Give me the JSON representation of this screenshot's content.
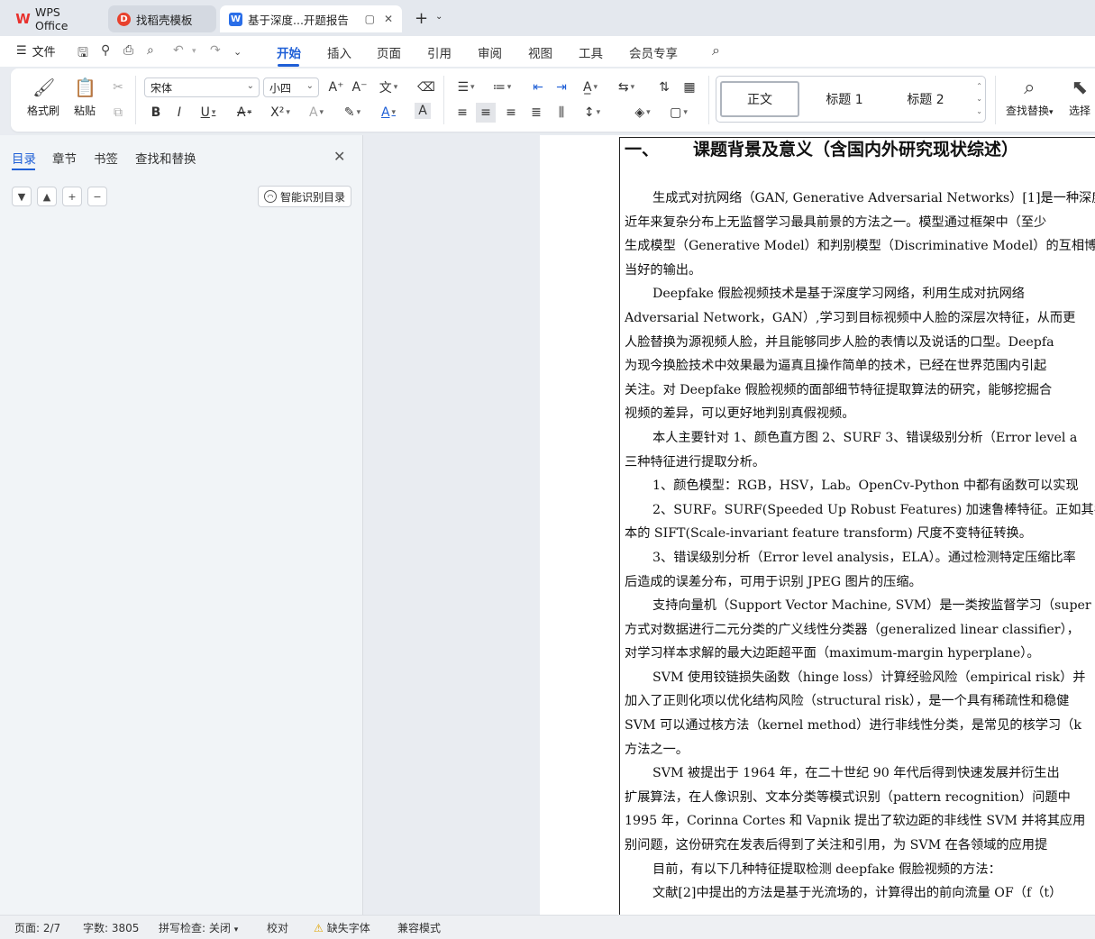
{
  "tabs": {
    "wps": "WPS Office",
    "templates": "找稻壳模板",
    "document": "基于深度...开题报告"
  },
  "menu": {
    "file": "文件",
    "items": [
      "开始",
      "插入",
      "页面",
      "引用",
      "审阅",
      "视图",
      "工具",
      "会员专享"
    ],
    "active": "开始"
  },
  "ribbon": {
    "format_painter": "格式刷",
    "paste": "粘贴",
    "font_name": "宋体",
    "font_size": "小四",
    "styles": [
      "正文",
      "标题 1",
      "标题 2"
    ],
    "find_replace": "查找替换",
    "select": "选择"
  },
  "nav": {
    "tabs": [
      "目录",
      "章节",
      "书签",
      "查找和替换"
    ],
    "active_tab": "目录",
    "smart_toc": "智能识别目录"
  },
  "document": {
    "heading": {
      "number": "一、",
      "text": "课题背景及意义（含国内外研究现状综述）"
    },
    "lines": [
      {
        "text": "生成式对抗网络（GAN, Generative Adversarial Networks）[1]是一种深度",
        "indent": true
      },
      {
        "text": "近年来复杂分布上无监督学习最具前景的方法之一。模型通过框架中（至少",
        "indent": false
      },
      {
        "text": "生成模型（Generative Model）和判别模型（Discriminative Model）的互相博",
        "indent": false
      },
      {
        "text": "当好的输出。",
        "indent": false
      },
      {
        "text": "Deepfake 假脸视频技术是基于深度学习网络，利用生成对抗网络",
        "indent": true
      },
      {
        "text": "Adversarial Network，GAN）,学习到目标视频中人脸的深层次特征，从而更",
        "indent": false
      },
      {
        "text": "人脸替换为源视频人脸，并且能够同步人脸的表情以及说话的口型。Deepfa",
        "indent": false
      },
      {
        "text": "为现今换脸技术中效果最为逼真且操作简单的技术，已经在世界范围内引起",
        "indent": false
      },
      {
        "text": "关注。对 Deepfake 假脸视频的面部细节特征提取算法的研究，能够挖掘合",
        "indent": false
      },
      {
        "text": "视频的差异，可以更好地判别真假视频。",
        "indent": false
      },
      {
        "text": "本人主要针对 1、颜色直方图  2、SURF 3、错误级别分析（Error level a",
        "indent": true
      },
      {
        "text": "三种特征进行提取分析。",
        "indent": false
      },
      {
        "text": "1、颜色模型：RGB，HSV，Lab。OpenCv-Python 中都有函数可以实现",
        "indent": true
      },
      {
        "text": "2、SURF。SURF(Speeded Up Robust Features) 加速鲁棒特征。正如其名",
        "indent": true
      },
      {
        "text": "本的  SIFT(Scale-invariant feature transform) 尺度不变特征转换。",
        "indent": false
      },
      {
        "text": "3、错误级别分析（Error level analysis，ELA）。通过检测特定压缩比率",
        "indent": true
      },
      {
        "text": "后造成的误差分布，可用于识别 JPEG 图片的压缩。",
        "indent": false
      },
      {
        "text": "支持向量机（Support Vector Machine, SVM）是一类按监督学习（super",
        "indent": true
      },
      {
        "text": "方式对数据进行二元分类的广义线性分类器（generalized linear classifier），",
        "indent": false
      },
      {
        "text": "对学习样本求解的最大边距超平面（maximum-margin hyperplane）。",
        "indent": false
      },
      {
        "text": "SVM 使用铰链损失函数（hinge loss）计算经验风险（empirical risk）并",
        "indent": true
      },
      {
        "text": "加入了正则化项以优化结构风险（structural risk），是一个具有稀疏性和稳健",
        "indent": false
      },
      {
        "text": "SVM 可以通过核方法（kernel method）进行非线性分类，是常见的核学习（k",
        "indent": false
      },
      {
        "text": "方法之一。",
        "indent": false
      },
      {
        "text": "SVM 被提出于 1964 年，在二十世纪 90 年代后得到快速发展并衍生出",
        "indent": true
      },
      {
        "text": "扩展算法，在人像识别、文本分类等模式识别（pattern recognition）问题中",
        "indent": false
      },
      {
        "text": "1995 年，Corinna Cortes 和 Vapnik 提出了软边距的非线性 SVM 并将其应用",
        "indent": false
      },
      {
        "text": "别问题，这份研究在发表后得到了关注和引用，为 SVM 在各领域的应用提",
        "indent": false
      },
      {
        "text": "目前，有以下几种特征提取检测 deepfake 假脸视频的方法：",
        "indent": true
      },
      {
        "text": "文献[2]中提出的方法是基于光流场的，计算得出的前向流量 OF（f（t）",
        "indent": true
      }
    ]
  },
  "status": {
    "page": "页面: 2/7",
    "words": "字数: 3805",
    "spell": "拼写检查: 关闭",
    "proof": "校对",
    "missing_font": "缺失字体",
    "compat": "兼容模式"
  }
}
